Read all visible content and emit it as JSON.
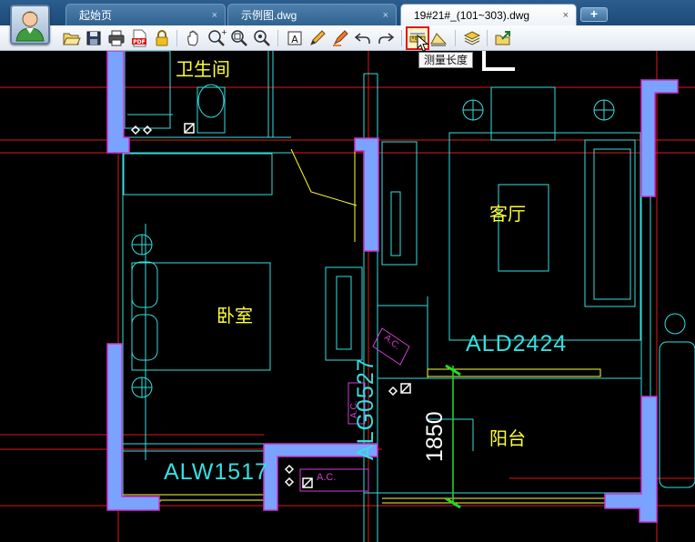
{
  "tabs": [
    {
      "label": "起始页",
      "close": "×"
    },
    {
      "label": "示例图.dwg",
      "close": "×"
    },
    {
      "label": "19#21#_(101~303).dwg",
      "close": "×"
    }
  ],
  "new_tab_label": "+",
  "toolbar": {
    "buttons": [
      "open-icon",
      "save-icon",
      "print-icon",
      "pdf-icon",
      "lock-icon",
      "pan-icon",
      "zoom-in-icon",
      "zoom-window-icon",
      "zoom-extent-icon",
      "text-icon",
      "pencil-icon",
      "highlighter-icon",
      "undo-icon",
      "redo-icon",
      "measure-length-icon",
      "measure-area-icon",
      "layers-icon",
      "export-icon"
    ],
    "tooltip": "测量长度"
  },
  "drawing": {
    "rooms": [
      "卫生间",
      "客厅",
      "卧室",
      "阳台"
    ],
    "tags": {
      "window_ald": "ALD2424",
      "window_alw": "ALW1517",
      "window_alg": "ALG0527",
      "dimension": "1850",
      "ac": "A.C."
    },
    "colors": {
      "wall": "#7aa2ff",
      "wall_outline": "#cc33cc",
      "line_cyan": "#33e0e0",
      "line_red": "#e01818",
      "text_yellow": "#ffff33",
      "green": "#22dd22",
      "white": "#ffffff"
    }
  }
}
